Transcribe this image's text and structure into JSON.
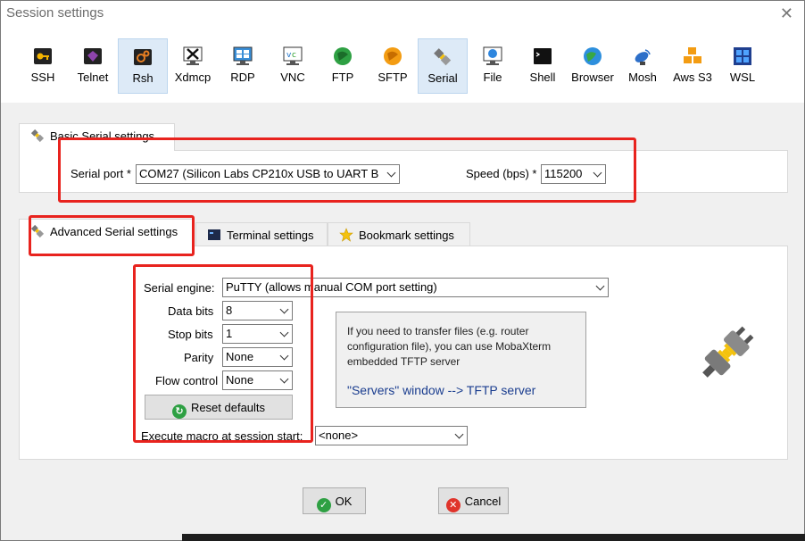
{
  "window": {
    "title": "Session settings"
  },
  "protocols": [
    {
      "label": "SSH",
      "icon": "key-icon"
    },
    {
      "label": "Telnet",
      "icon": "gem-icon"
    },
    {
      "label": "Rsh",
      "icon": "rsh-gears-icon",
      "active": true
    },
    {
      "label": "Xdmcp",
      "icon": "x-monitor-icon"
    },
    {
      "label": "RDP",
      "icon": "rdp-monitor-icon"
    },
    {
      "label": "VNC",
      "icon": "vnc-monitor-icon"
    },
    {
      "label": "FTP",
      "icon": "ftp-globe-icon"
    },
    {
      "label": "SFTP",
      "icon": "sftp-globe-icon"
    },
    {
      "label": "Serial",
      "icon": "serial-plug-icon",
      "active": true
    },
    {
      "label": "File",
      "icon": "file-monitor-icon"
    },
    {
      "label": "Shell",
      "icon": "shell-terminal-icon"
    },
    {
      "label": "Browser",
      "icon": "browser-globe-icon"
    },
    {
      "label": "Mosh",
      "icon": "satellite-icon"
    },
    {
      "label": "Aws S3",
      "icon": "aws-cubes-icon"
    },
    {
      "label": "WSL",
      "icon": "windows-logo-icon"
    }
  ],
  "basic": {
    "tab_label": "Basic Serial settings",
    "serial_port_label": "Serial port *",
    "serial_port_value": "COM27  (Silicon Labs CP210x USB to UART B",
    "speed_label": "Speed (bps) *",
    "speed_value": "115200"
  },
  "advanced_tabs": [
    {
      "label": "Advanced Serial settings",
      "icon": "serial-plug-icon",
      "selected": true
    },
    {
      "label": "Terminal settings",
      "icon": "terminal-icon"
    },
    {
      "label": "Bookmark settings",
      "icon": "star-icon"
    }
  ],
  "advanced": {
    "engine_label": "Serial engine:",
    "engine_value": "PuTTY    (allows manual COM port setting)",
    "data_bits_label": "Data bits",
    "data_bits_value": "8",
    "stop_bits_label": "Stop bits",
    "stop_bits_value": "1",
    "parity_label": "Parity",
    "parity_value": "None",
    "flow_label": "Flow control",
    "flow_value": "None",
    "reset_label": "Reset defaults",
    "macro_label": "Execute macro at session start:",
    "macro_value": "<none>",
    "info_text": "If you need to transfer files (e.g. router configuration file), you can use MobaXterm embedded TFTP server",
    "info_link": "\"Servers\" window  -->  TFTP server"
  },
  "buttons": {
    "ok": "OK",
    "cancel": "Cancel"
  },
  "colors": {
    "highlight": "#e8231e",
    "link": "#1a3d8f",
    "active_bg": "#ddeaf7"
  }
}
